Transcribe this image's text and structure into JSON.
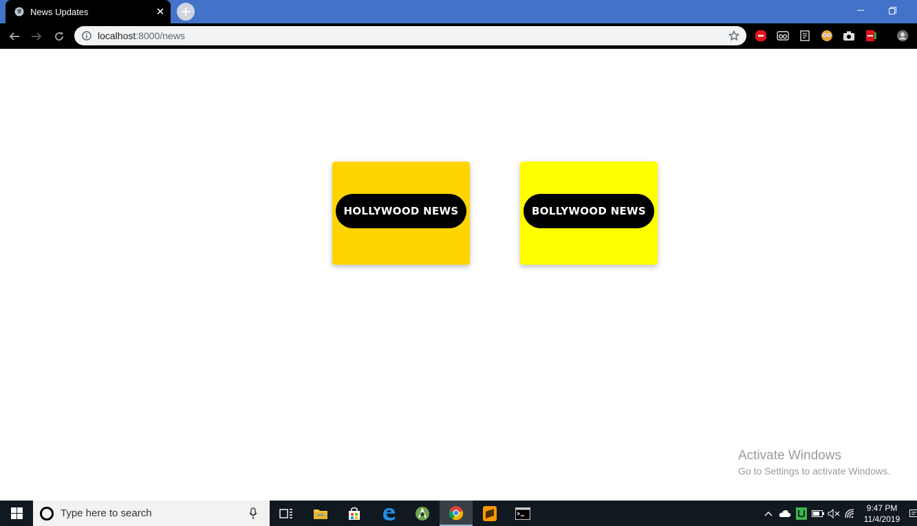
{
  "browser": {
    "tab_title": "News Updates",
    "tab_close": "✕",
    "url_host": "localhost",
    "url_rest": ":8000/news"
  },
  "page": {
    "cards": [
      {
        "label": "HOLLYWOOD NEWS",
        "color": "#ffd500"
      },
      {
        "label": "BOLLYWOOD NEWS",
        "color": "#ffff00"
      }
    ],
    "watermark_title": "Activate Windows",
    "watermark_sub": "Go to Settings to activate Windows."
  },
  "taskbar": {
    "search_placeholder": "Type here to search",
    "time": "9:47 PM",
    "date": "11/4/2019",
    "apps": [
      "task-view-icon",
      "file-explorer-icon",
      "store-icon",
      "edge-icon",
      "android-studio-icon",
      "chrome-icon",
      "sublime-icon",
      "terminal-icon"
    ]
  },
  "extensions": [
    "abp-icon",
    "glasses-icon",
    "docs-icon",
    "owl-icon",
    "camera-icon",
    "pdf-icon",
    "profile-icon"
  ]
}
